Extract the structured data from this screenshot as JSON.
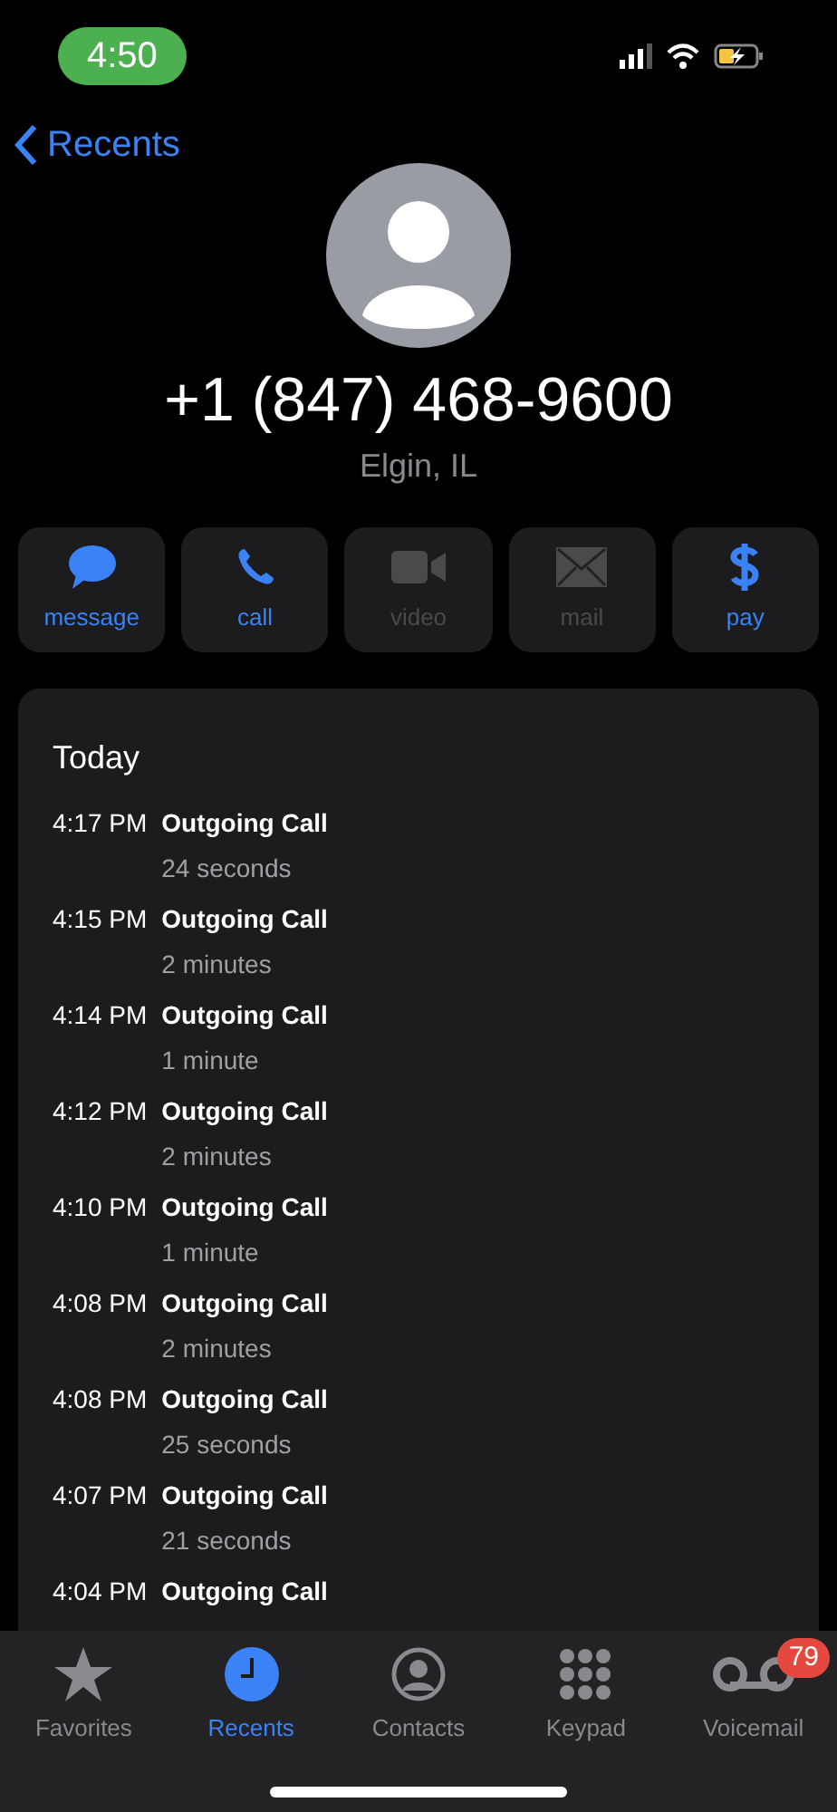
{
  "status_bar": {
    "time": "4:50"
  },
  "nav": {
    "back_label": "Recents"
  },
  "contact": {
    "number": "+1 (847) 468-9600",
    "location": "Elgin, IL"
  },
  "actions": [
    {
      "kind": "message",
      "label": "message",
      "disabled": false
    },
    {
      "kind": "call",
      "label": "call",
      "disabled": false
    },
    {
      "kind": "video",
      "label": "video",
      "disabled": true
    },
    {
      "kind": "mail",
      "label": "mail",
      "disabled": true
    },
    {
      "kind": "pay",
      "label": "pay",
      "disabled": false
    }
  ],
  "history": {
    "heading": "Today",
    "calls": [
      {
        "time": "4:17 PM",
        "type": "Outgoing Call",
        "duration": "24 seconds"
      },
      {
        "time": "4:15 PM",
        "type": "Outgoing Call",
        "duration": "2 minutes"
      },
      {
        "time": "4:14 PM",
        "type": "Outgoing Call",
        "duration": "1 minute"
      },
      {
        "time": "4:12 PM",
        "type": "Outgoing Call",
        "duration": "2 minutes"
      },
      {
        "time": "4:10 PM",
        "type": "Outgoing Call",
        "duration": "1 minute"
      },
      {
        "time": "4:08 PM",
        "type": "Outgoing Call",
        "duration": "2 minutes"
      },
      {
        "time": "4:08 PM",
        "type": "Outgoing Call",
        "duration": "25 seconds"
      },
      {
        "time": "4:07 PM",
        "type": "Outgoing Call",
        "duration": "21 seconds"
      },
      {
        "time": "4:04 PM",
        "type": "Outgoing Call"
      }
    ]
  },
  "tabs": [
    {
      "kind": "favorites",
      "label": "Favorites",
      "selected": false
    },
    {
      "kind": "recents",
      "label": "Recents",
      "selected": true
    },
    {
      "kind": "contacts",
      "label": "Contacts",
      "selected": false
    },
    {
      "kind": "keypad",
      "label": "Keypad",
      "selected": false
    },
    {
      "kind": "voicemail",
      "label": "Voicemail",
      "selected": false,
      "badge": "79"
    }
  ]
}
